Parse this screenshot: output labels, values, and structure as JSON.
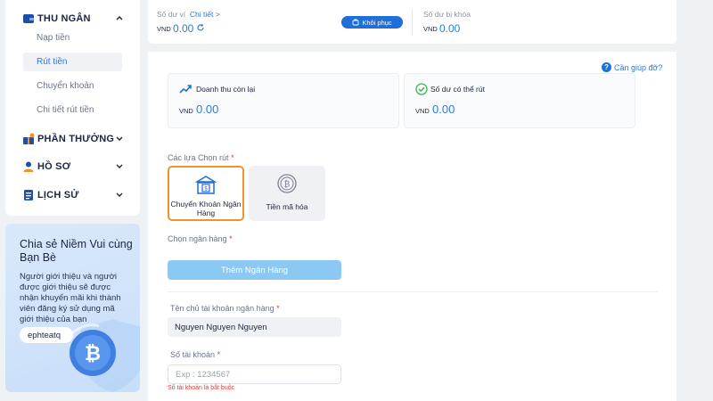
{
  "sidebar": {
    "cashier": {
      "label": "THU NGÂN",
      "items": [
        "Nạp tiền",
        "Rút tiền",
        "Chuyển khoản",
        "Chi tiết rút tiền"
      ]
    },
    "rewards_label": "PHẦN THƯỞNG",
    "profile_label": "HỒ SƠ",
    "history_label": "LỊCH SỬ"
  },
  "promo": {
    "title": "Chia sẻ Niềm Vui cùng Bạn Bè",
    "body": "Người giới thiệu và người được giới thiệu sẽ được nhận khuyến mãi khi thành viên đăng ký sử dụng mã giới thiệu của bạn",
    "code": "ephteatq"
  },
  "balance": {
    "wallet_label": "Số dư ví",
    "details_link": "Chi tiết >",
    "currency": "VND",
    "wallet_amount": "0.00",
    "restore_label": "Khôi phục",
    "locked_label": "Số dư bị khóa",
    "locked_amount": "0.00"
  },
  "main": {
    "help_label": "Cần giúp đỡ?",
    "remaining_revenue_label": "Doanh thu còn lại",
    "remaining_revenue_amount": "0.00",
    "withdrawable_label": "Số dư có thể rút",
    "withdrawable_amount": "0.00",
    "currency": "VND",
    "withdraw_options_label": "Các lựa Chọn rút",
    "options": [
      "Chuyển Khoản Ngân Hàng",
      "Tiền mã hóa"
    ],
    "choose_bank_label": "Chọn ngân hàng",
    "add_bank_label": "Thêm Ngân Hàng",
    "account_holder_label": "Tên chủ tài khoản ngân hàng",
    "account_holder_value": "Nguyen Nguyen Nguyen",
    "account_number_label": "Số tài khoản",
    "account_number_placeholder": "Exp : 1234567",
    "account_number_error": "Số tài khoản là bắt buộc",
    "required_mark": "*"
  },
  "colors": {
    "accent": "#2e7ad8",
    "button": "#1f6fd8",
    "selected_border": "#f0932b",
    "error": "#e53935"
  }
}
